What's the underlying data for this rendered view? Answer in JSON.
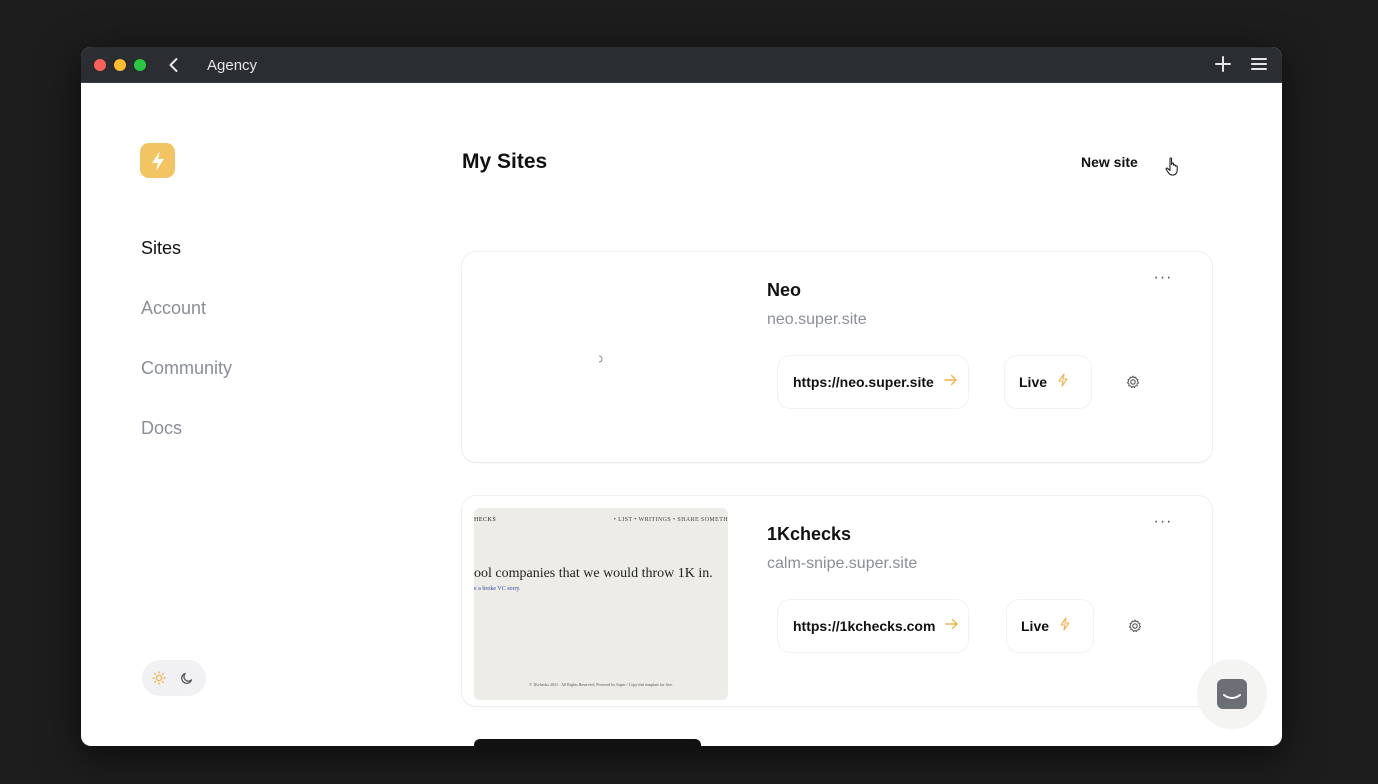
{
  "window": {
    "title": "Agency"
  },
  "sidebar": {
    "items": [
      {
        "label": "Sites",
        "active": true
      },
      {
        "label": "Account",
        "active": false
      },
      {
        "label": "Community",
        "active": false
      },
      {
        "label": "Docs",
        "active": false
      }
    ],
    "theme": {
      "selected": "light",
      "icons": [
        "sun-icon",
        "moon-icon"
      ]
    }
  },
  "main": {
    "title": "My Sites",
    "new_site_label": "New site",
    "sites": [
      {
        "name": "Neo",
        "domain": "neo.super.site",
        "url": "https://neo.super.site",
        "status": "Live",
        "thumbnail": "loading"
      },
      {
        "name": "1Kchecks",
        "domain": "calm-snipe.super.site",
        "url": "https://1kchecks.com",
        "status": "Live",
        "thumbnail": {
          "brand": "HECKS",
          "nav": "• LIST  • WRITINGS  • SHARE SOMETH",
          "headline": "ool companies that we would throw 1K in.",
          "subline": "e a broke VC sorry.",
          "footer": "© 1Kchecks 2021 · All Rights Reserved | Powered by Super / Copy this template for free."
        }
      }
    ]
  },
  "colors": {
    "accent": "#f2c462",
    "arrow": "#f2b24c",
    "titlebar": "#2a2d32"
  }
}
